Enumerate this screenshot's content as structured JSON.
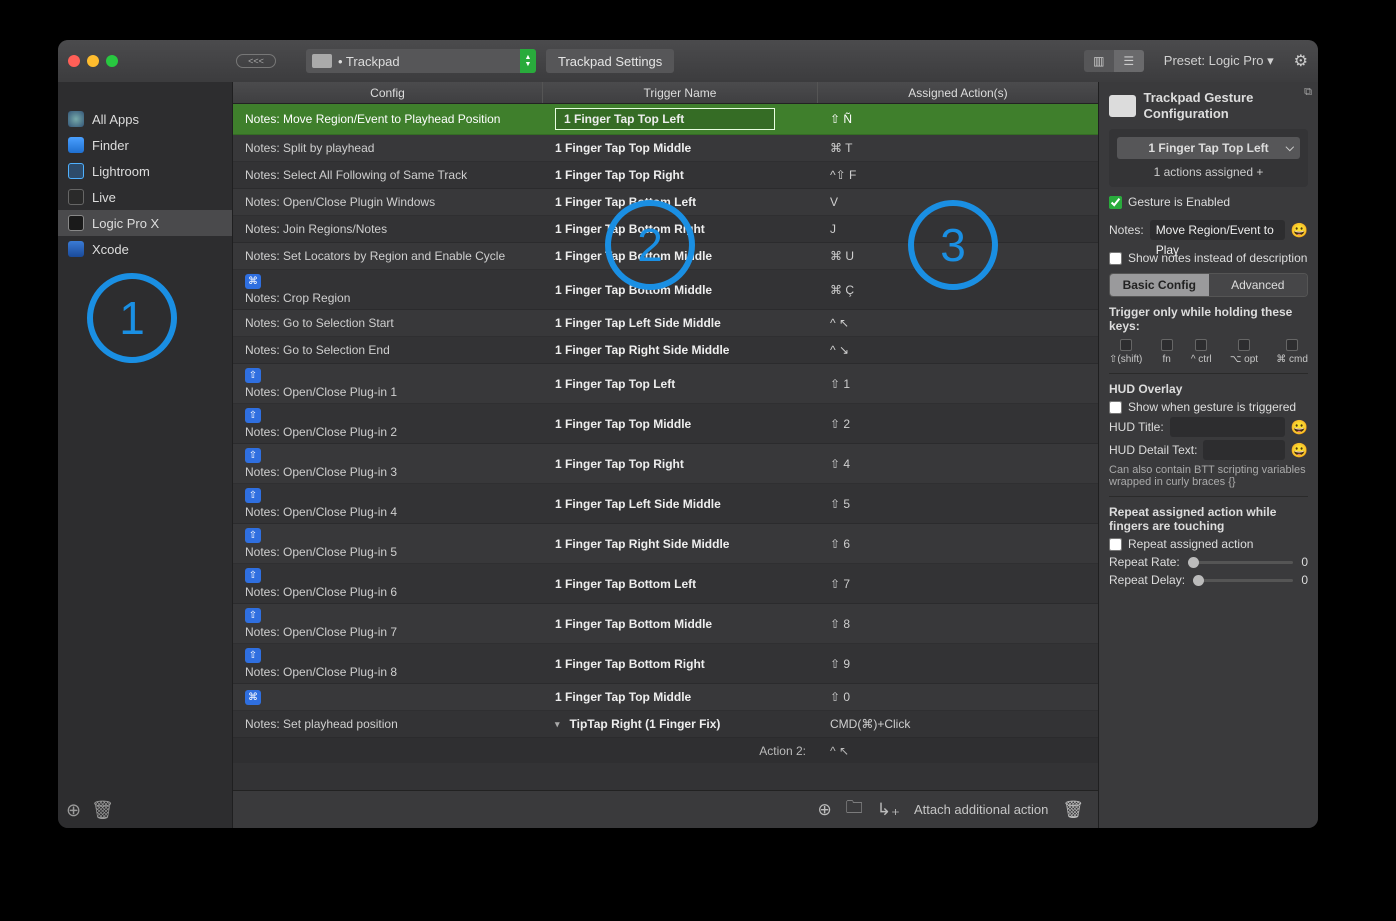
{
  "toolbar": {
    "back_pill": "<<<",
    "dropdown_label": "• Trackpad",
    "settings_label": "Trackpad Settings",
    "preset_label": "Preset: Logic Pro ▾"
  },
  "sidebar": {
    "items": [
      {
        "label": "All Apps",
        "icon": "globe"
      },
      {
        "label": "Finder",
        "icon": "finder"
      },
      {
        "label": "Lightroom",
        "icon": "lr"
      },
      {
        "label": "Live",
        "icon": "live"
      },
      {
        "label": "Logic Pro X",
        "icon": "logic",
        "selected": true
      },
      {
        "label": "Xcode",
        "icon": "xcode"
      }
    ]
  },
  "table": {
    "headers": {
      "config": "Config",
      "trigger": "Trigger Name",
      "action": "Assigned Action(s)"
    },
    "rows": [
      {
        "config": "Notes: Move Region/Event to Playhead Position",
        "trigger": "1 Finger Tap Top Left",
        "action": "⇧ Ñ",
        "selected": true
      },
      {
        "config": "Notes: Split by playhead",
        "trigger": "1 Finger Tap Top Middle",
        "action": "⌘ T"
      },
      {
        "config": "Notes: Select All Following of Same Track",
        "trigger": "1 Finger Tap Top Right",
        "action": "^⇧ F"
      },
      {
        "config": "Notes: Open/Close Plugin Windows",
        "trigger": "1 Finger Tap Bottom Left",
        "action": "V"
      },
      {
        "config": "Notes: Join Regions/Notes",
        "trigger": "1 Finger Tap Bottom Right",
        "action": "J"
      },
      {
        "config": "Notes: Set Locators by Region and Enable Cycle",
        "trigger": "1 Finger Tap Bottom Middle",
        "action": "⌘ U"
      },
      {
        "badge": "⌘",
        "config": "Notes: Crop Region",
        "trigger": "1 Finger Tap Bottom Middle",
        "action": "⌘ Ç",
        "tall": true
      },
      {
        "config": "Notes: Go to Selection Start",
        "trigger": "1 Finger Tap Left Side Middle",
        "action": "^ ↖"
      },
      {
        "config": "Notes: Go to Selection End",
        "trigger": "1 Finger Tap Right Side Middle",
        "action": "^ ↘"
      },
      {
        "badge": "⇧",
        "config": "Notes: Open/Close Plug-in 1",
        "trigger": "1 Finger Tap Top Left",
        "action": "⇧ 1",
        "tall": true
      },
      {
        "badge": "⇧",
        "config": "Notes: Open/Close Plug-in 2",
        "trigger": "1 Finger Tap Top Middle",
        "action": "⇧ 2",
        "tall": true
      },
      {
        "badge": "⇧",
        "config": "Notes: Open/Close Plug-in 3",
        "trigger": "1 Finger Tap Top Right",
        "action": "⇧ 4",
        "tall": true
      },
      {
        "badge": "⇧",
        "config": "Notes: Open/Close Plug-in 4",
        "trigger": "1 Finger Tap Left Side Middle",
        "action": "⇧ 5",
        "tall": true
      },
      {
        "badge": "⇧",
        "config": "Notes: Open/Close Plug-in 5",
        "trigger": "1 Finger Tap Right Side Middle",
        "action": "⇧ 6",
        "tall": true
      },
      {
        "badge": "⇧",
        "config": "Notes: Open/Close Plug-in 6",
        "trigger": "1 Finger Tap Bottom Left",
        "action": "⇧ 7",
        "tall": true
      },
      {
        "badge": "⇧",
        "config": "Notes: Open/Close Plug-in 7",
        "trigger": "1 Finger Tap Bottom Middle",
        "action": "⇧ 8",
        "tall": true
      },
      {
        "badge": "⇧",
        "config": "Notes: Open/Close Plug-in 8",
        "trigger": "1 Finger Tap Bottom Right",
        "action": "⇧ 9",
        "tall": true
      },
      {
        "badge": "⌘",
        "config": "",
        "trigger": "1 Finger Tap Top Middle",
        "action": "⇧ 0"
      },
      {
        "config": "Notes: Set playhead position",
        "trigger": "TipTap Right (1 Finger Fix)",
        "action": "CMD(⌘)+Click",
        "tri": true
      }
    ],
    "subrow": {
      "label": "Action 2:",
      "action": "^ ↖"
    }
  },
  "bottom": {
    "attach": "Attach additional action"
  },
  "inspector": {
    "title": "Trackpad Gesture Configuration",
    "gesture": "1 Finger Tap Top Left",
    "assigned": "1 actions assigned +",
    "enabled_label": "Gesture is Enabled",
    "notes_label": "Notes:",
    "notes_value": "Move Region/Event to Play",
    "show_notes": "Show notes instead of description",
    "tab_basic": "Basic Config",
    "tab_adv": "Advanced",
    "trigger_only": "Trigger only while holding these keys:",
    "keys": [
      "⇧(shift)",
      "fn",
      "^ ctrl",
      "⌥ opt",
      "⌘ cmd"
    ],
    "hud_title": "HUD Overlay",
    "hud_show": "Show when gesture is triggered",
    "hud_t": "HUD Title:",
    "hud_d": "HUD Detail Text:",
    "hud_note": "Can also contain BTT scripting variables wrapped in curly braces {}",
    "repeat_title": "Repeat assigned action while fingers are touching",
    "repeat_cb": "Repeat assigned action",
    "rate": "Repeat Rate:",
    "rate_v": "0",
    "delay": "Repeat Delay:",
    "delay_v": "0"
  },
  "overlays": {
    "n1": "1",
    "n2": "2",
    "n3": "3"
  }
}
